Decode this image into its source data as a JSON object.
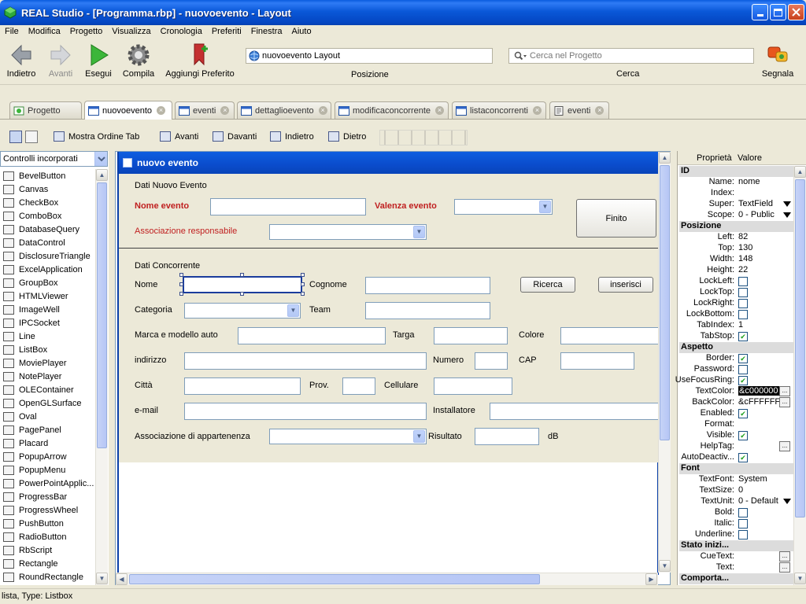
{
  "window": {
    "title": "REAL Studio - [Programma.rbp] - nuovoevento - Layout"
  },
  "menu": [
    "File",
    "Modifica",
    "Progetto",
    "Visualizza",
    "Cronologia",
    "Preferiti",
    "Finestra",
    "Aiuto"
  ],
  "toolbar": {
    "back": "Indietro",
    "forward": "Avanti",
    "run": "Esegui",
    "build": "Compila",
    "bookmark": "Aggiungi Preferito",
    "location_value": "nuovoevento Layout",
    "location_label": "Posizione",
    "search_placeholder": "Cerca nel Progetto",
    "search_label": "Cerca",
    "report": "Segnala"
  },
  "tabs": [
    "Progetto",
    "nuovoevento",
    "eventi",
    "dettaglioevento",
    "modificaconcorrente",
    "listaconcorrenti",
    "eventi"
  ],
  "layout_toolbar": {
    "tab_order": "Mostra Ordine Tab",
    "forward": "Avanti",
    "front": "Davanti",
    "backward": "Indietro",
    "back": "Dietro"
  },
  "controls_panel": {
    "selected": "Controlli incorporati",
    "items": [
      "BevelButton",
      "Canvas",
      "CheckBox",
      "ComboBox",
      "DatabaseQuery",
      "DataControl",
      "DisclosureTriangle",
      "ExcelApplication",
      "GroupBox",
      "HTMLViewer",
      "ImageWell",
      "IPCSocket",
      "Line",
      "ListBox",
      "MoviePlayer",
      "NotePlayer",
      "OLEContainer",
      "OpenGLSurface",
      "Oval",
      "PagePanel",
      "Placard",
      "PopupArrow",
      "PopupMenu",
      "PowerPointApplic...",
      "ProgressBar",
      "ProgressWheel",
      "PushButton",
      "RadioButton",
      "RbScript",
      "Rectangle",
      "RoundRectangle"
    ]
  },
  "form": {
    "window_title": "nuovo evento",
    "group1": "Dati Nuovo Evento",
    "nome_evento": "Nome evento",
    "valenza_evento": "Valenza evento",
    "finito": "Finito",
    "associazione_responsabile": "Associazione responsabile",
    "group2": "Dati Concorrente",
    "nome": "Nome",
    "cognome": "Cognome",
    "ricerca": "Ricerca",
    "inserisci": "inserisci",
    "categoria": "Categoria",
    "team": "Team",
    "marca": "Marca e modello auto",
    "targa": "Targa",
    "colore": "Colore",
    "indirizzo": "indirizzo",
    "numero": "Numero",
    "cap": "CAP",
    "citta": "Città",
    "prov": "Prov.",
    "cellulare": "Cellulare",
    "email": "e-mail",
    "installatore": "Installatore",
    "associazione_appartenenza": "Associazione di appartenenza",
    "risultato": "Risultato",
    "db": "dB"
  },
  "properties": {
    "header_name": "Proprietà",
    "header_value": "Valore",
    "sections": {
      "id": "ID",
      "position": "Posizione",
      "appearance": "Aspetto",
      "font": "Font",
      "initial_state": "Stato inizi...",
      "behavior": "Comporta..."
    },
    "rows": {
      "name": {
        "label": "Name:",
        "value": "nome"
      },
      "index": {
        "label": "Index:",
        "value": ""
      },
      "super": {
        "label": "Super:",
        "value": "TextField"
      },
      "scope": {
        "label": "Scope:",
        "value": "0 - Public"
      },
      "left": {
        "label": "Left:",
        "value": "82"
      },
      "top": {
        "label": "Top:",
        "value": "130"
      },
      "width": {
        "label": "Width:",
        "value": "148"
      },
      "height": {
        "label": "Height:",
        "value": "22"
      },
      "lockleft": {
        "label": "LockLeft:",
        "checked": false
      },
      "locktop": {
        "label": "LockTop:",
        "checked": false
      },
      "lockright": {
        "label": "LockRight:",
        "checked": false
      },
      "lockbottom": {
        "label": "LockBottom:",
        "checked": false
      },
      "tabindex": {
        "label": "TabIndex:",
        "value": "1"
      },
      "tabstop": {
        "label": "TabStop:",
        "checked": true
      },
      "border": {
        "label": "Border:",
        "checked": true
      },
      "password": {
        "label": "Password:",
        "checked": false
      },
      "usefocusring": {
        "label": "UseFocusRing:",
        "checked": true
      },
      "textcolor": {
        "label": "TextColor:",
        "value": "&c000000"
      },
      "backcolor": {
        "label": "BackColor:",
        "value": "&cFFFFFF"
      },
      "enabled": {
        "label": "Enabled:",
        "checked": true
      },
      "format": {
        "label": "Format:",
        "value": ""
      },
      "visible": {
        "label": "Visible:",
        "checked": true
      },
      "helptag": {
        "label": "HelpTag:",
        "value": ""
      },
      "autodeactivate": {
        "label": "AutoDeactiv...",
        "checked": true
      },
      "textfont": {
        "label": "TextFont:",
        "value": "System"
      },
      "textsize": {
        "label": "TextSize:",
        "value": "0"
      },
      "textunit": {
        "label": "TextUnit:",
        "value": "0 - Default"
      },
      "bold": {
        "label": "Bold:",
        "checked": false
      },
      "italic": {
        "label": "Italic:",
        "checked": false
      },
      "underline": {
        "label": "Underline:",
        "checked": false
      },
      "cuetext": {
        "label": "CueText:",
        "value": ""
      },
      "text": {
        "label": "Text:",
        "value": ""
      }
    }
  },
  "status": "lista, Type: Listbox"
}
